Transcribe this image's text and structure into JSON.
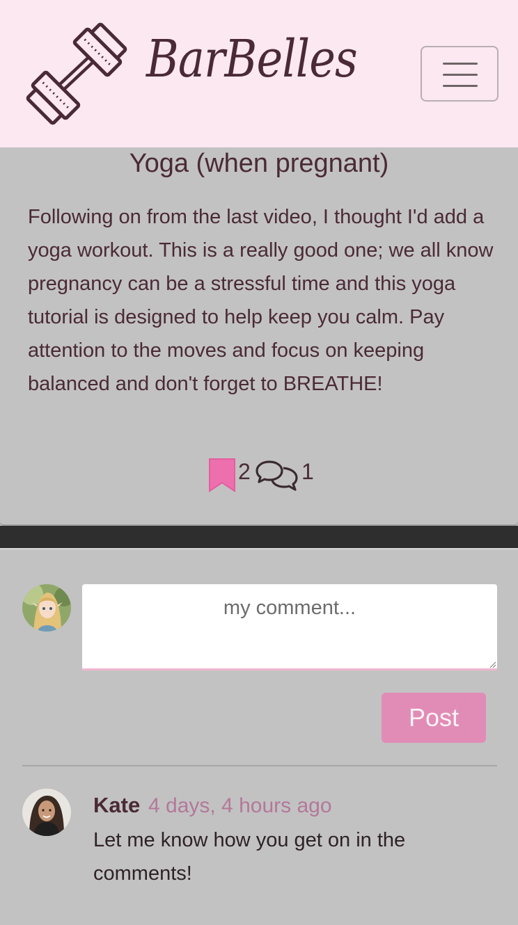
{
  "navbar": {
    "brand": "BarBelles",
    "logo_icon": "dumbbell-icon",
    "menu_icon": "hamburger-menu-icon"
  },
  "post": {
    "title": "Yoga (when pregnant)",
    "body": "Following on from the last video, I thought I'd add a yoga workout. This is a really good one; we all know pregnancy can be a stressful time and this yoga tutorial is designed to help keep you calm. Pay attention to the moves and focus on keeping balanced and don't forget to BREATHE!",
    "like_count": "2",
    "comment_count": "1",
    "bookmark_icon": "bookmark-icon",
    "comment_icon": "comments-icon"
  },
  "comment_form": {
    "placeholder": "my comment...",
    "value": "",
    "submit_label": "Post"
  },
  "comments": [
    {
      "author": "Kate",
      "time": "4 days, 4 hours ago",
      "text": "Let me know how you get on in the comments!"
    }
  ],
  "colors": {
    "brand_text": "#4a2a36",
    "header_bg": "#fbe8f0",
    "page_bg": "#c2c2c2",
    "accent_pink": "#e18cb6",
    "bookmark_pink": "#ee6fae",
    "timestamp": "#b3789a"
  }
}
